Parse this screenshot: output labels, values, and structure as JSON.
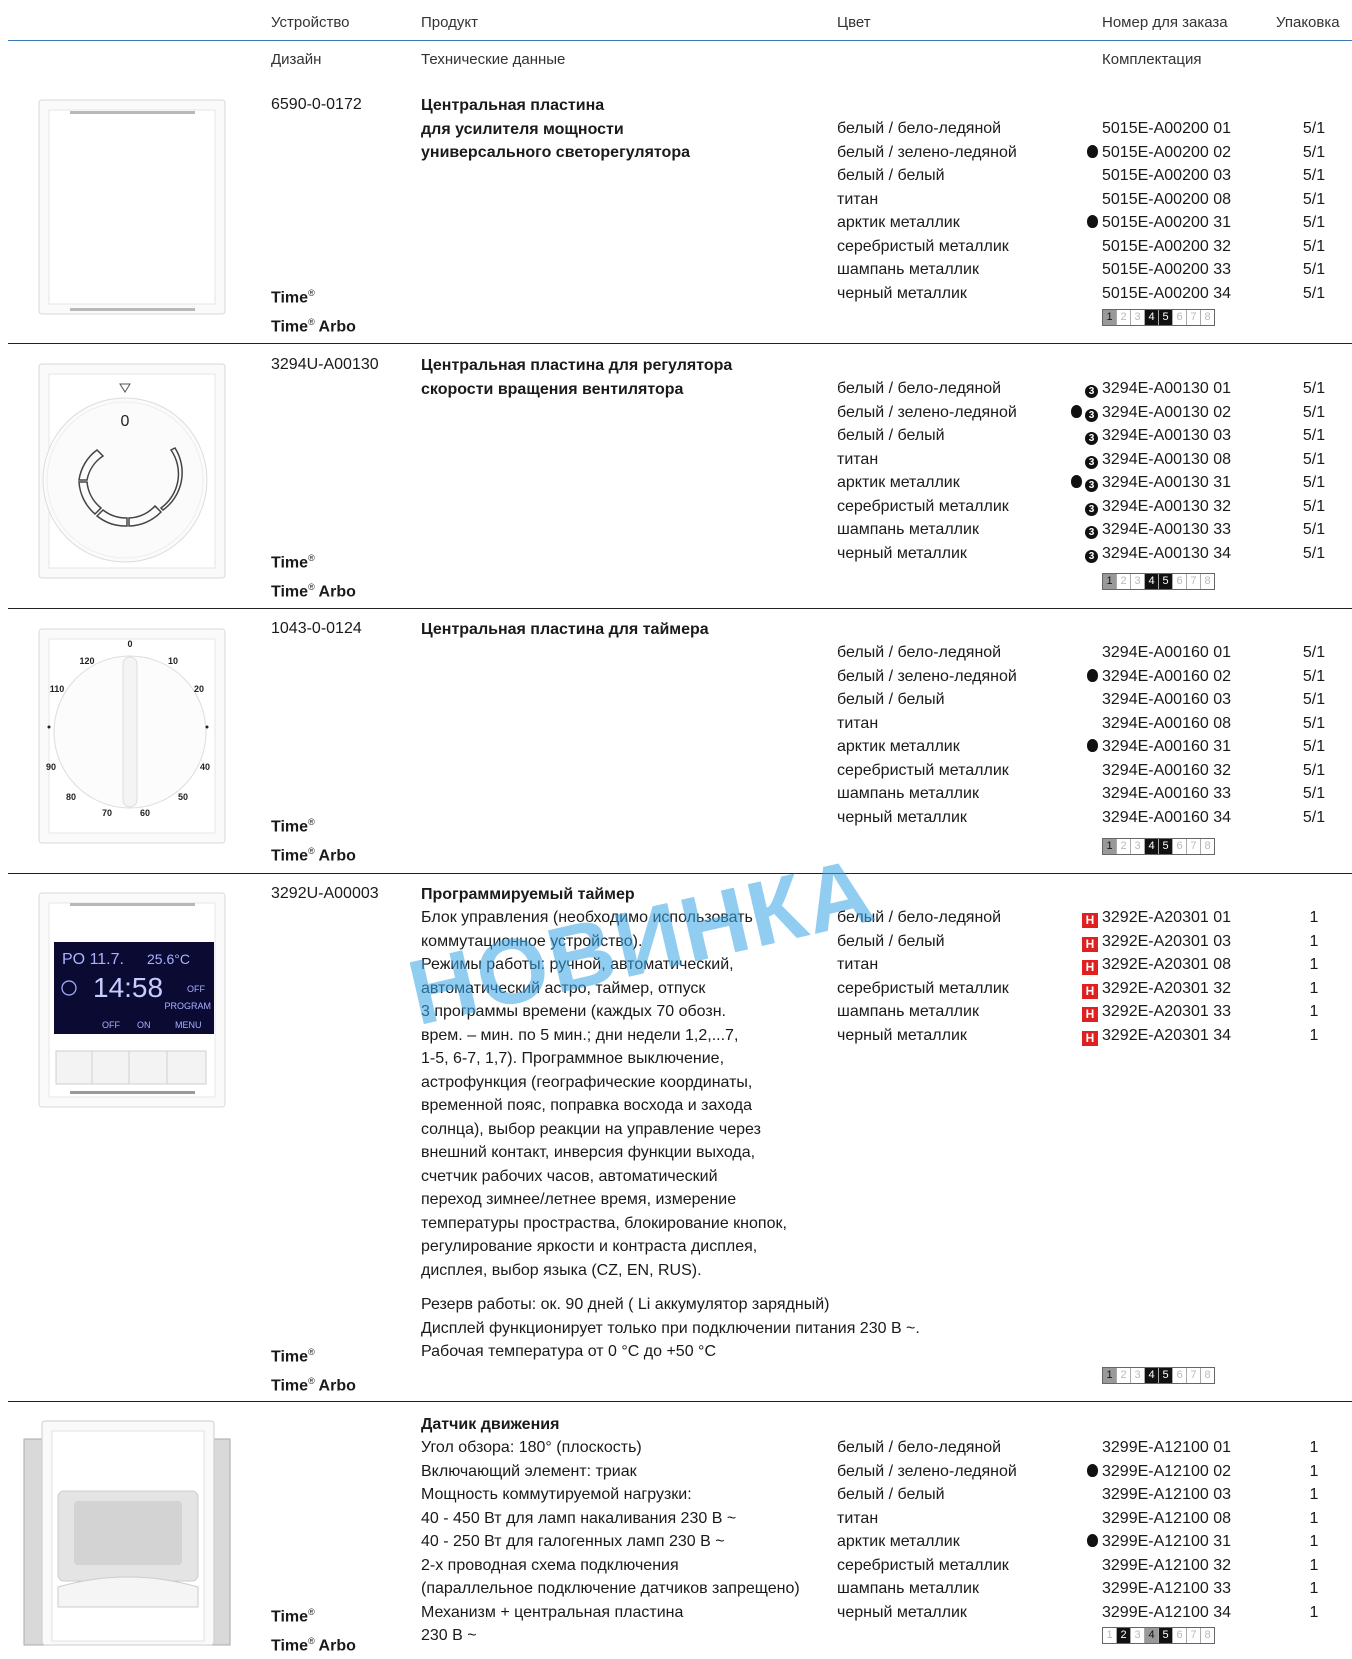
{
  "header": {
    "col1": "Устройство",
    "col2": "Продукт",
    "col3": "Цвет",
    "col4": "Номер для заказа",
    "col5": "Упаковка",
    "sub1": "Дизайн",
    "sub2": "Технические данные",
    "sub4": "Комплектация"
  },
  "brand": {
    "time": "Time",
    "arbo": " Arbo",
    "reg": "®"
  },
  "watermark": "НОВИНКА",
  "rows": [
    {
      "code": "6590-0-0172",
      "title": [
        "Центральная пластина",
        "для усилителя мощности",
        "универсального светорегулятора"
      ],
      "colors": [
        "белый / бело-ледяной",
        "белый / зелено-ледяной",
        "белый / белый",
        "титан",
        "арктик металлик",
        "серебристый металлик",
        "шампань металлик",
        "черный металлик"
      ],
      "orders": [
        "5015E-A00200 01",
        "5015E-A00200 02",
        "5015E-A00200 03",
        "5015E-A00200 08",
        "5015E-A00200 31",
        "5015E-A00200 32",
        "5015E-A00200 33",
        "5015E-A00200 34"
      ],
      "packs": [
        "5/1",
        "5/1",
        "5/1",
        "5/1",
        "5/1",
        "5/1",
        "5/1",
        "5/1"
      ]
    },
    {
      "code": "3294U-A00130",
      "title": [
        "Центральная пластина для регулятора",
        "скорости вращения вентилятора"
      ],
      "colors": [
        "белый / бело-ледяной",
        "белый / зелено-ледяной",
        "белый / белый",
        "титан",
        "арктик металлик",
        "серебристый металлик",
        "шампань металлик",
        "черный металлик"
      ],
      "orders": [
        "3294E-A00130 01",
        "3294E-A00130 02",
        "3294E-A00130 03",
        "3294E-A00130 08",
        "3294E-A00130 31",
        "3294E-A00130 32",
        "3294E-A00130 33",
        "3294E-A00130 34"
      ],
      "packs": [
        "5/1",
        "5/1",
        "5/1",
        "5/1",
        "5/1",
        "5/1",
        "5/1",
        "5/1"
      ],
      "dial_label": "0"
    },
    {
      "code": "1043-0-0124",
      "title": [
        "Центральная пластина для таймера"
      ],
      "colors": [
        "белый / бело-ледяной",
        "белый / зелено-ледяной",
        "белый / белый",
        "титан",
        "арктик металлик",
        "серебристый металлик",
        "шампань металлик",
        "черный металлик"
      ],
      "orders": [
        "3294E-A00160 01",
        "3294E-A00160 02",
        "3294E-A00160 03",
        "3294E-A00160 08",
        "3294E-A00160 31",
        "3294E-A00160 32",
        "3294E-A00160 33",
        "3294E-A00160 34"
      ],
      "packs": [
        "5/1",
        "5/1",
        "5/1",
        "5/1",
        "5/1",
        "5/1",
        "5/1",
        "5/1"
      ],
      "dial_ticks": [
        "0",
        "10",
        "20",
        "40",
        "50",
        "60",
        "70",
        "80",
        "90",
        "110",
        "120"
      ]
    },
    {
      "code": "3292U-A00003",
      "title": [
        "Программируемый таймер"
      ],
      "desc": [
        "Блок управления (необходимо использовать",
        "коммутационное устройство).",
        "Режимы работы: ручной, автоматический,",
        "автоматический астро, таймер, отпуск",
        "3 программы времени (каждых 70 обозн.",
        "врем. – мин. по 5 мин.; дни недели 1,2,...7,",
        "1-5, 6-7, 1,7). Программное выключение,",
        "астрофункция (географические координаты,",
        "временной пояс, поправка восхода и захода",
        "солнца), выбор реакции на управление через",
        "внешний контакт, инверсия функции выхода,",
        "счетчик рабочих часов, автоматический",
        "переход зимнее/летнее время, измерение",
        "температуры простраства, блокирование кнопок,",
        "регулирование яркости и контраста дисплея,",
        "дисплея, выбор языка (CZ, EN, RUS)."
      ],
      "desc2": [
        "Резерв работы: ок. 90 дней ( Li аккумулятор зарядный)",
        "Дисплей функционирует только при подключении питания 230 В ~.",
        "Рабочая температура от 0 °C до +50 °C"
      ],
      "colors": [
        "белый / бело-ледяной",
        "белый / белый",
        "титан",
        "серебристый металлик",
        "шампань металлик",
        "черный металлик"
      ],
      "orders": [
        "3292E-A20301 01",
        "3292E-A20301 03",
        "3292E-A20301 08",
        "3292E-A20301 32",
        "3292E-A20301 33",
        "3292E-A20301 34"
      ],
      "packs": [
        "1",
        "1",
        "1",
        "1",
        "1",
        "1"
      ],
      "marker": "H",
      "display": {
        "line1a": "PO 11.7.",
        "line1b": "25.6°C",
        "time": "14:58",
        "off": "OFF",
        "program": "PROGRAM",
        "btn_off": "OFF",
        "btn_on": "ON",
        "btn_menu": "MENU"
      }
    },
    {
      "title": [
        "Датчик движения"
      ],
      "desc": [
        "Угол обзора: 180° (плоскость)",
        "Включающий элемент: триак",
        "Мощность коммутируемой нагрузки:",
        "40 - 450 Вт для ламп накаливания 230 В ~",
        "40 - 250 Вт для галогенных ламп 230 В ~",
        "2-х проводная схема подключения",
        "(параллельное подключение датчиков запрещено)",
        "Механизм + центральная пластина",
        "230 В ~"
      ],
      "colors": [
        "белый / бело-ледяной",
        "белый / зелено-ледяной",
        "белый / белый",
        "титан",
        "арктик металлик",
        "серебристый металлик",
        "шампань металлик",
        "черный металлик"
      ],
      "orders": [
        "3299E-A12100 01",
        "3299E-A12100 02",
        "3299E-A12100 03",
        "3299E-A12100 08",
        "3299E-A12100 31",
        "3299E-A12100 32",
        "3299E-A12100 33",
        "3299E-A12100 34"
      ],
      "packs": [
        "1",
        "1",
        "1",
        "1",
        "1",
        "1",
        "1",
        "1"
      ]
    }
  ],
  "scale_digits": [
    "1",
    "2",
    "3",
    "4",
    "5",
    "6",
    "7",
    "8"
  ]
}
